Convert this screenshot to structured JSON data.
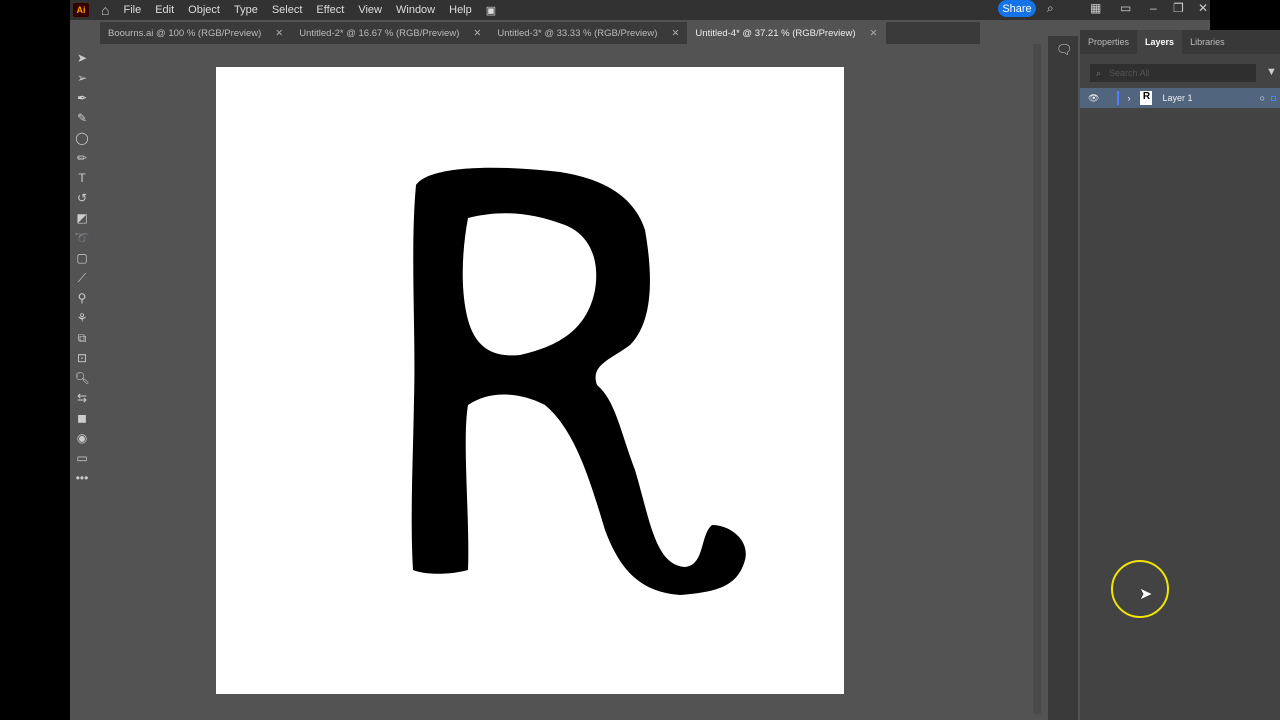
{
  "menubar": {
    "items": [
      "File",
      "Edit",
      "Object",
      "Type",
      "Select",
      "Effect",
      "View",
      "Window",
      "Help"
    ],
    "share": "Share",
    "logo": "Ai"
  },
  "tabs": [
    {
      "label": "Boourns.ai @ 100 % (RGB/Preview)"
    },
    {
      "label": "Untitled-2* @ 16.67 % (RGB/Preview)"
    },
    {
      "label": "Untitled-3* @ 33.33 % (RGB/Preview)"
    },
    {
      "label": "Untitled-4* @ 37.21 % (RGB/Preview)",
      "active": true
    }
  ],
  "panel": {
    "tabs": [
      "Properties",
      "Layers",
      "Libraries"
    ],
    "active_tab": "Layers",
    "search_placeholder": "Search All",
    "layers": [
      {
        "name": "Layer 1",
        "color": "#4f7fff"
      }
    ]
  },
  "colors": {
    "accent": "#1473e6",
    "cursor_highlight": "#f2e600"
  }
}
